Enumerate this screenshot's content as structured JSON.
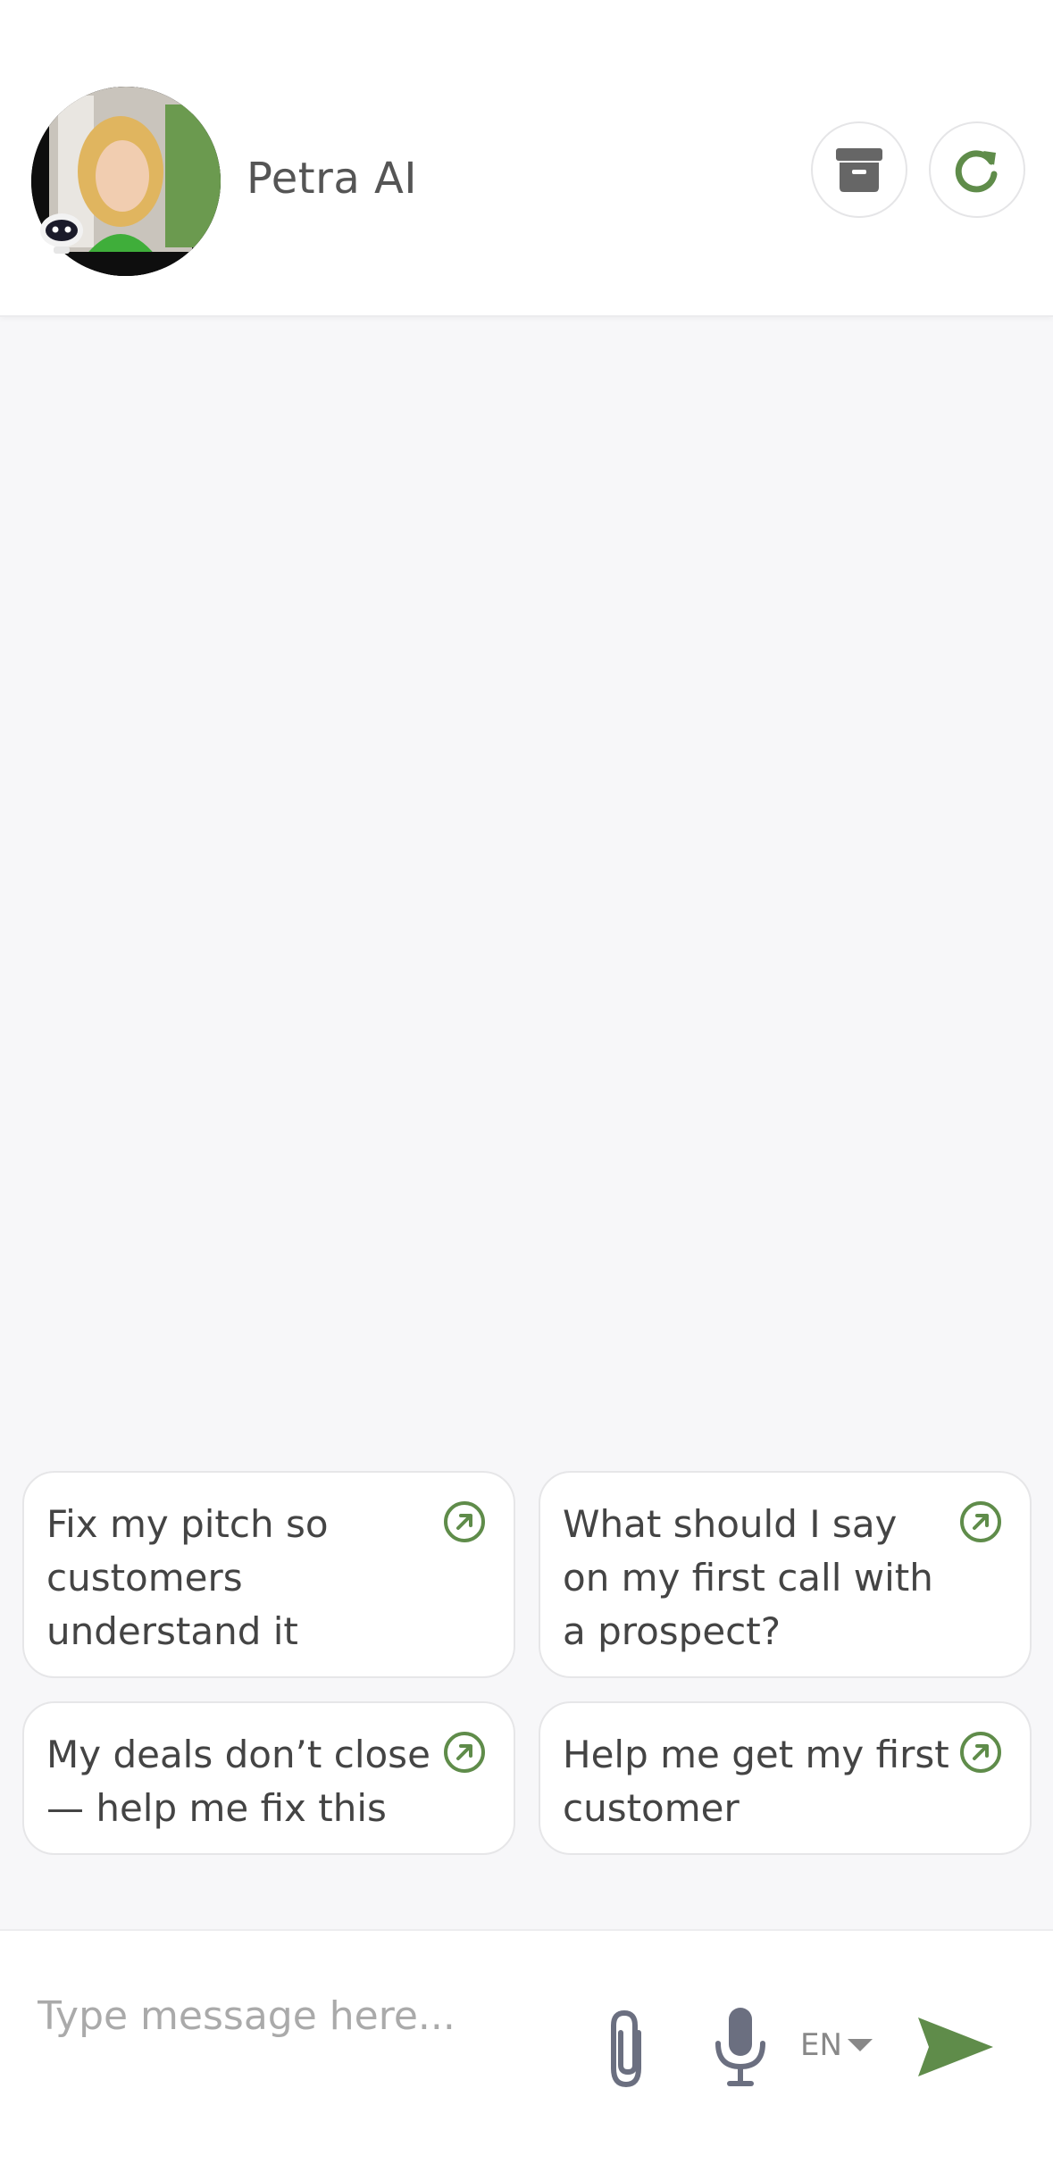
{
  "header": {
    "title": "Petra AI"
  },
  "suggestions": [
    {
      "text": "Fix my pitch so customers understand it"
    },
    {
      "text": "What should I say on my first call with a prospect?"
    },
    {
      "text": "My deals don’t close — help me fix this"
    },
    {
      "text": "Help me get my first customer"
    }
  ],
  "input": {
    "placeholder": "Type message here...",
    "value": ""
  },
  "language": {
    "selected": "EN"
  },
  "colors": {
    "accent": "#5f8c4a",
    "icon_gray": "#6b6f80",
    "archive_gray": "#666666"
  }
}
